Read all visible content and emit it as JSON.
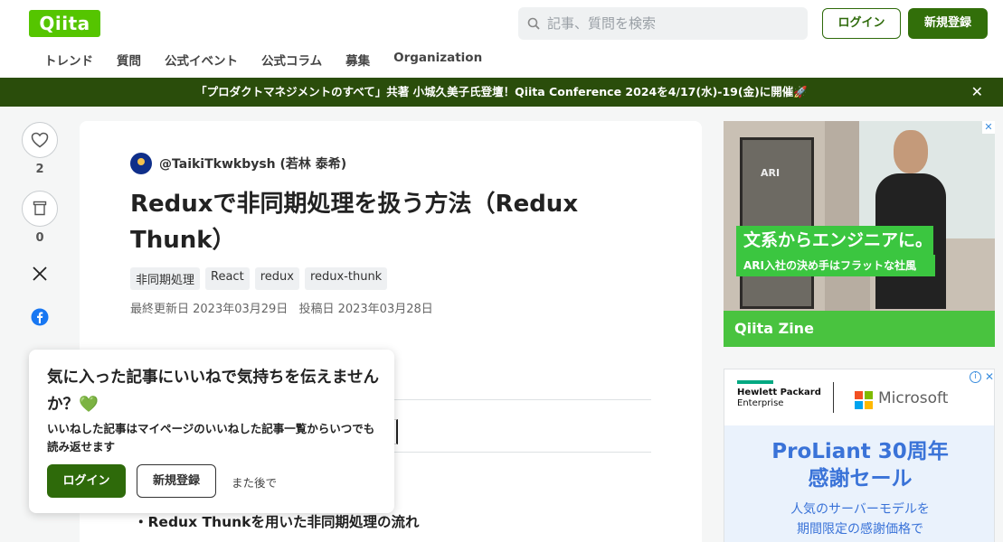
{
  "header": {
    "logo": "Qiita",
    "search_placeholder": "記事、質問を検索",
    "login": "ログイン",
    "signup": "新規登録",
    "nav": [
      "トレンド",
      "質問",
      "公式イベント",
      "公式コラム",
      "募集",
      "Organization"
    ]
  },
  "banner": {
    "text": "「プロダクトマネジメントのすべて」共著 小城久美子氏登壇！Qiita Conference 2024を4/17(水)-19(金)に開催🚀",
    "close": "✕"
  },
  "side": {
    "like_count": "2",
    "stock_count": "0"
  },
  "article": {
    "author": "@TaikiTkwkbysh (若林 泰希)",
    "title": "Reduxで非同期処理を扱う方法（Redux Thunk）",
    "tags": [
      "非同期処理",
      "React",
      "redux",
      "redux-thunk"
    ],
    "updated": "最終更新日 2023年03月29日",
    "posted": "投稿日 2023年03月28日",
    "bullet": "・Redux Thunkを用いた非同期処理の流れ"
  },
  "popup": {
    "title": "気に入った記事にいいねで気持ちを伝えませんか？💚",
    "desc": "いいねした記事はマイページのいいねした記事一覧からいつでも読み返せます",
    "login": "ログイン",
    "signup": "新規登録",
    "later": "また後で"
  },
  "ad1": {
    "line1": "文系からエンジニアに。",
    "line2": "ARI入社の決め手はフラットな社風",
    "footer": "Qiita Zine",
    "sign": "ARI"
  },
  "ad2": {
    "hpe_line1": "Hewlett Packard",
    "hpe_line2": "Enterprise",
    "ms": "Microsoft",
    "headline1": "ProLiant 30周年",
    "headline2": "感謝セール",
    "copy1": "人気のサーバーモデルを",
    "copy2": "期間限定の感謝価格で"
  },
  "colors": {
    "brand_green": "#55c500",
    "dark_green": "#2e6a0a",
    "banner_bg": "#2a4d0b"
  }
}
